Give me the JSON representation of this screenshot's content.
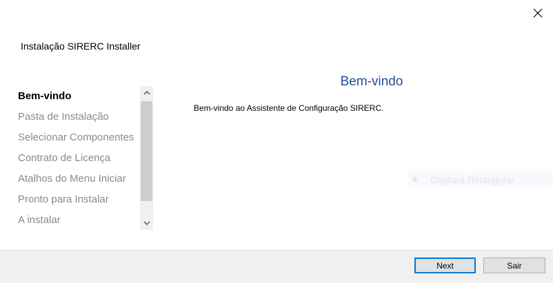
{
  "window": {
    "title": "Instalação SIRERC Installer",
    "close_icon": "close-icon"
  },
  "sidebar": {
    "items": [
      {
        "label": "Bem-vindo",
        "active": true
      },
      {
        "label": "Pasta de Instalação",
        "active": false
      },
      {
        "label": "Selecionar Componentes",
        "active": false
      },
      {
        "label": "Contrato de Licença",
        "active": false
      },
      {
        "label": "Atalhos do Menu Iniciar",
        "active": false
      },
      {
        "label": "Pronto para Instalar",
        "active": false
      },
      {
        "label": "A instalar",
        "active": false
      }
    ],
    "scroll_up_icon": "chevron-up-icon",
    "scroll_down_icon": "chevron-down-icon"
  },
  "main": {
    "heading": "Bem-vindo",
    "text": "Bem-vindo ao Assistente de Configuração SIRERC."
  },
  "overlay": {
    "label": "Captura Retangular"
  },
  "footer": {
    "next_label": "Next",
    "cancel_label": "Sair"
  },
  "colors": {
    "heading": "#1f4e9c",
    "active_item": "#000000",
    "inactive_item": "#8a8a8a",
    "default_button_border": "#0078d7",
    "footer_bg": "#f0f0f0"
  }
}
